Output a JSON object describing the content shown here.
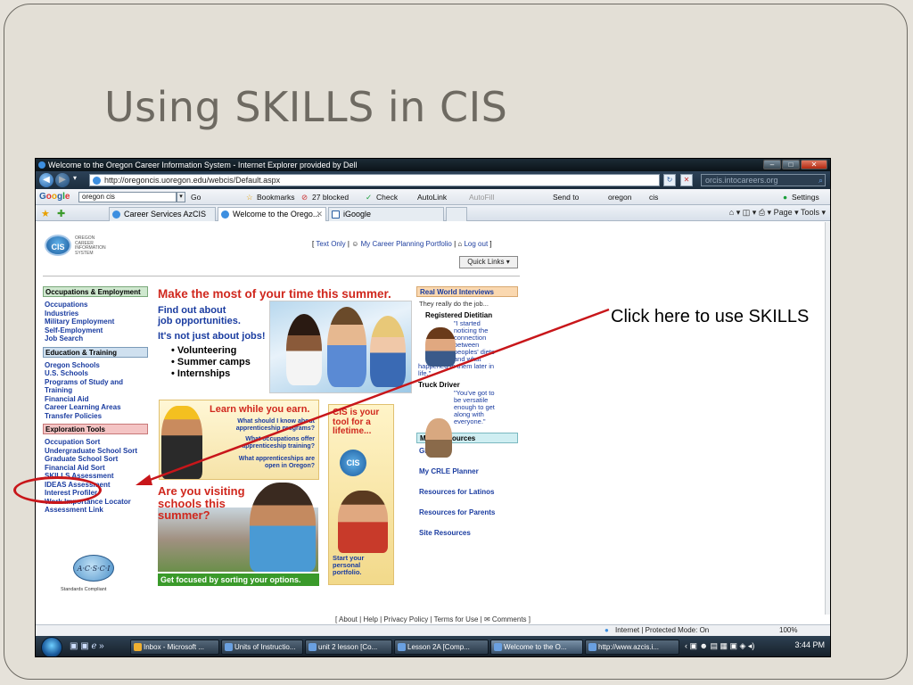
{
  "slide": {
    "title": "Using SKILLS in CIS",
    "callout": "Click here to use SKILLS"
  },
  "browser": {
    "window_title": "Welcome to the Oregon Career Information System - Internet Explorer provided by Dell",
    "url": "http://oregoncis.uoregon.edu/webcis/Default.aspx",
    "search_value": "orcis.intocareers.org",
    "google_toolbar": {
      "logo": "Google",
      "search_value": "oregon cis",
      "go_label": "Go",
      "bookmarks_label": "Bookmarks",
      "blocked_label": "27 blocked",
      "check_label": "Check",
      "autolink_label": "AutoLink",
      "autofill_label": "AutoFill",
      "sendto_label": "Send to",
      "oregon_label": "oregon",
      "cis_label": "cis",
      "settings_label": "Settings"
    },
    "tabs": [
      {
        "label": "Career Services AzCIS"
      },
      {
        "label": "Welcome to the Orego..."
      },
      {
        "label": "iGoogle"
      }
    ],
    "command_bar": {
      "page_label": "Page",
      "tools_label": "Tools"
    },
    "status": {
      "zone": "Internet | Protected Mode: On",
      "zoom": "100%"
    },
    "taskbar": {
      "items": [
        {
          "label": "Inbox - Microsoft ..."
        },
        {
          "label": "Units of Instructio..."
        },
        {
          "label": "unit 2 lesson [Co..."
        },
        {
          "label": "Lesson 2A [Comp..."
        },
        {
          "label": "Welcome to the O..."
        },
        {
          "label": "http://www.azcis.i..."
        }
      ],
      "clock": "3:44 PM"
    }
  },
  "cis": {
    "logo": "CIS",
    "logo_text": "OREGON CAREER INFORMATION SYSTEM",
    "topnav": {
      "text_only": "Text Only",
      "portfolio": "My Career Planning Portfolio",
      "logout": "Log out"
    },
    "quick_links": "Quick Links",
    "leftnav": [
      {
        "heading": "Occupations & Employment",
        "links": [
          "Occupations",
          "Industries",
          "Military Employment",
          "Self-Employment",
          "Job Search"
        ]
      },
      {
        "heading": "Education & Training",
        "links": [
          "Oregon Schools",
          "U.S. Schools",
          "Programs of Study and",
          "Training",
          "Financial Aid",
          "Career Learning Areas",
          "Transfer Policies"
        ]
      },
      {
        "heading": "Exploration Tools",
        "links": [
          "Occupation Sort",
          "Undergraduate School Sort",
          "Graduate School Sort",
          "Financial Aid Sort",
          "SKILLS Assessment",
          "IDEAS Assessment",
          "Interest Profiler",
          "Work Importance Locator",
          "Assessment Link"
        ]
      }
    ],
    "standards_caption": "Standards Compliant",
    "acsci_badge": "A·C·S·C·I",
    "main": {
      "headline": "Make the most of your time this summer.",
      "find_out": [
        "Find out about",
        "job opportunities."
      ],
      "not_just": "It's not just about jobs!",
      "bullets": [
        "Volunteering",
        "Summer camps",
        "Internships"
      ],
      "earn_title": "Learn while you earn.",
      "earn_questions": [
        "What should I know about apprenticeship programs?",
        "What occupations offer apprenticeship training?",
        "What apprenticeships are open in Oregon?"
      ],
      "visit_heading": [
        "Are you visiting",
        "schools this",
        "summer?"
      ],
      "visit_banner": "Get focused by sorting your options.",
      "tool_heading": [
        "CIS is your",
        "tool for a",
        "lifetime..."
      ],
      "tool_logo_small": "OREGON",
      "tool_logo": "CIS",
      "tool_bottom": [
        "Start your",
        "personal",
        "portfolio."
      ]
    },
    "right": {
      "interviews_heading": "Real World Interviews",
      "interviews_sub": "They really do the job...",
      "dietitian_title": "Registered Dietitian",
      "dietitian_quote": [
        "\"I started",
        "noticing the",
        "connection",
        "between",
        "peoples' diets",
        "and what"
      ],
      "dietitian_quote_end": [
        "happened to them later in",
        "life.\""
      ],
      "trucker_title": "Truck Driver",
      "trucker_quote": [
        "\"You've got to",
        "be versatile",
        "enough to get",
        "along with",
        "everyone.\""
      ],
      "resources_heading": "More Resources",
      "resource_links": [
        "Glossary",
        "My CRLE Planner",
        "Resources for Latinos",
        "Resources for Parents",
        "Site Resources"
      ]
    },
    "footer": {
      "about": "About",
      "help": "Help",
      "privacy": "Privacy Policy",
      "terms": "Terms for Use",
      "comments": "Comments"
    }
  },
  "colors": {
    "slide_bg": "#e3dfd6",
    "title_color": "#6e6a62",
    "annotation_red": "#c8161a",
    "cis_red": "#d0281e",
    "cis_blue": "#1a3ca0"
  }
}
